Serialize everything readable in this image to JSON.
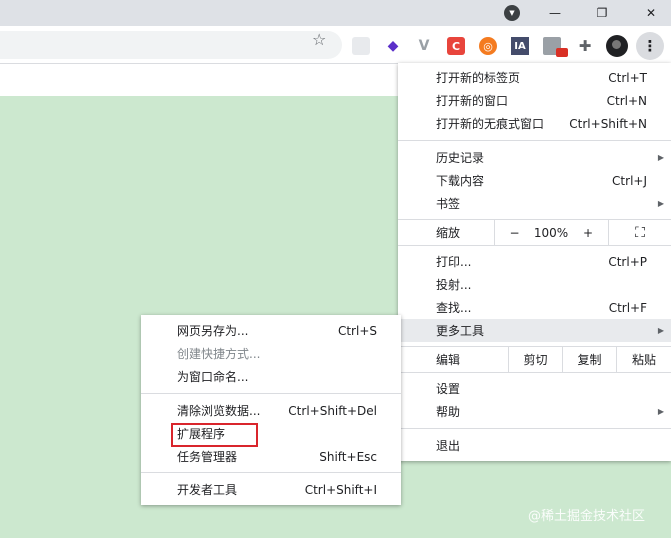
{
  "window": {
    "minimize_glyph": "—",
    "maximize_glyph": "❐",
    "close_glyph": "✕",
    "tab_dropdown_glyph": "▼"
  },
  "toolbar": {
    "bookmark_glyph": "☆",
    "menu_glyph": "⋮",
    "extensions": [
      {
        "name": "gray-square-icon",
        "glyph": ""
      },
      {
        "name": "purple-layers-icon",
        "glyph": "◆"
      },
      {
        "name": "v-icon",
        "glyph": "V"
      },
      {
        "name": "c-icon",
        "glyph": "C"
      },
      {
        "name": "lifebuoy-icon",
        "glyph": "◎"
      },
      {
        "name": "ia-icon",
        "glyph": "IA"
      },
      {
        "name": "grid-icon",
        "glyph": ""
      },
      {
        "name": "puzzle-icon",
        "glyph": "✚"
      }
    ]
  },
  "main_menu": {
    "new_tab": {
      "label": "打开新的标签页",
      "shortcut": "Ctrl+T"
    },
    "new_window": {
      "label": "打开新的窗口",
      "shortcut": "Ctrl+N"
    },
    "incognito": {
      "label": "打开新的无痕式窗口",
      "shortcut": "Ctrl+Shift+N"
    },
    "history": {
      "label": "历史记录"
    },
    "downloads": {
      "label": "下载内容",
      "shortcut": "Ctrl+J"
    },
    "bookmarks": {
      "label": "书签"
    },
    "zoom": {
      "label": "缩放",
      "minus": "−",
      "value": "100%",
      "plus": "+",
      "fullscreen": "⛶"
    },
    "print": {
      "label": "打印...",
      "shortcut": "Ctrl+P"
    },
    "cast": {
      "label": "投射..."
    },
    "find": {
      "label": "查找...",
      "shortcut": "Ctrl+F"
    },
    "more_tools": {
      "label": "更多工具"
    },
    "edit": {
      "label": "编辑",
      "cut": "剪切",
      "copy": "复制",
      "paste": "粘贴"
    },
    "settings": {
      "label": "设置"
    },
    "help": {
      "label": "帮助"
    },
    "exit": {
      "label": "退出"
    },
    "arrow": "▶"
  },
  "sub_menu": {
    "save_page": {
      "label": "网页另存为...",
      "shortcut": "Ctrl+S"
    },
    "create_shortcut": {
      "label": "创建快捷方式..."
    },
    "name_window": {
      "label": "为窗口命名..."
    },
    "clear_data": {
      "label": "清除浏览数据...",
      "shortcut": "Ctrl+Shift+Del"
    },
    "extensions": {
      "label": "扩展程序"
    },
    "task_manager": {
      "label": "任务管理器",
      "shortcut": "Shift+Esc"
    },
    "dev_tools": {
      "label": "开发者工具",
      "shortcut": "Ctrl+Shift+I"
    }
  },
  "watermark": "@稀土掘金技术社区"
}
